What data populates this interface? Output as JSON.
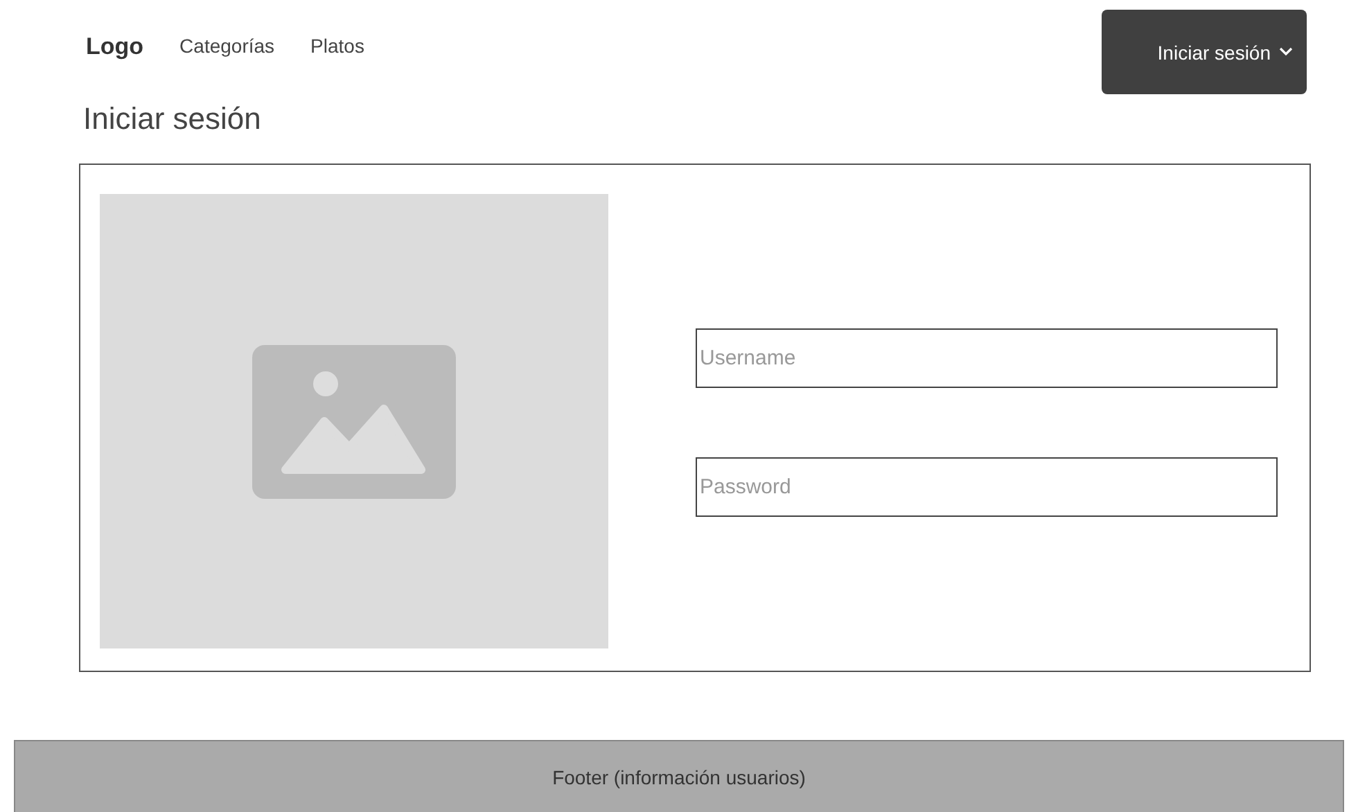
{
  "nav": {
    "logo": "Logo",
    "links": [
      "Categorías",
      "Platos"
    ],
    "login_button": "Iniciar sesión"
  },
  "page_title": "Iniciar sesión",
  "form": {
    "fields": [
      {
        "placeholder": "Username"
      },
      {
        "placeholder": "Password"
      }
    ]
  },
  "footer": "Footer (información usuarios)"
}
